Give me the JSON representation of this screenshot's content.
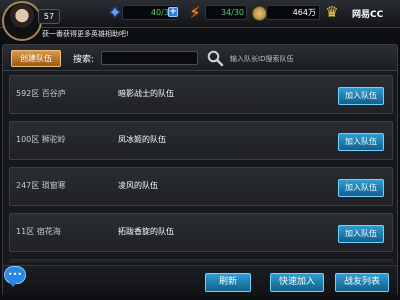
{
  "player": {
    "level": "57"
  },
  "resources": {
    "energy": "40/30",
    "stamina": "34/30",
    "coins": "464万"
  },
  "brand": "网易CC",
  "ticker": "获一番获得更多英雄相助吧!",
  "toolbar": {
    "create_team": "创建队伍",
    "search_label": "搜索:",
    "search_value": "",
    "search_hint": "输入队长ID搜索队伍"
  },
  "teams": [
    {
      "region": "592区 百谷庐",
      "team": "暗影战士的队伍",
      "join": "加入队伍"
    },
    {
      "region": "100区 狮驼岭",
      "team": "凤冰姬的队伍",
      "join": "加入队伍"
    },
    {
      "region": "247区 琐窗寒",
      "team": "凌风的队伍",
      "join": "加入队伍"
    },
    {
      "region": "11区 宿花海",
      "team": "拓跋香旋的队伍",
      "join": "加入队伍"
    },
    {
      "region": "",
      "team": "",
      "join": ""
    }
  ],
  "bottom": {
    "refresh": "刷新",
    "quick_join": "快速加入",
    "friend_list": "战友列表"
  },
  "colors": {
    "accent_blue": "#2f9dd4",
    "create_orange": "#d89a45",
    "value_green": "#53d47a"
  }
}
